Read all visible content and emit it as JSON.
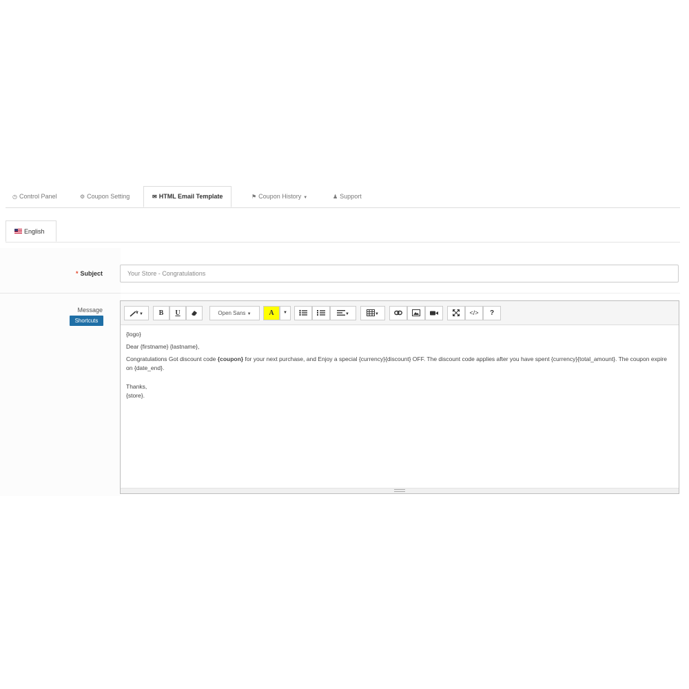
{
  "tabs": [
    {
      "label": "Control Panel",
      "icon": "clock-icon"
    },
    {
      "label": "Coupon Setting",
      "icon": "gear-icon"
    },
    {
      "label": "HTML Email Template",
      "icon": "envelope-icon"
    },
    {
      "label": "Coupon History",
      "icon": "tag-icon"
    },
    {
      "label": "Support",
      "icon": "user-icon"
    }
  ],
  "language_tab": {
    "label": "English"
  },
  "subject": {
    "label": "Subject",
    "value": "Your Store - Congratulations"
  },
  "message": {
    "label": "Message",
    "shortcuts_label": "Shortcuts"
  },
  "toolbar": {
    "font_name": "Open Sans",
    "bold": "B",
    "underline": "U",
    "color": "A",
    "help": "?"
  },
  "body": {
    "line1": "{logo}",
    "line2": "Dear {firstname} {lastname},",
    "line3_pre": "Congratulations Got discount code ",
    "line3_bold": "{coupon}",
    "line3_post": " for your next purchase, and  Enjoy a special {currency}{discount} OFF. The discount code applies after you have spent {currency}{total_amount}. The coupon expire on {date_end}.",
    "line4": "Thanks,",
    "line5": "{store}."
  },
  "colors": {
    "accent": "#1f6fa6",
    "highlight": "#ffff00",
    "required": "#e4472b"
  }
}
